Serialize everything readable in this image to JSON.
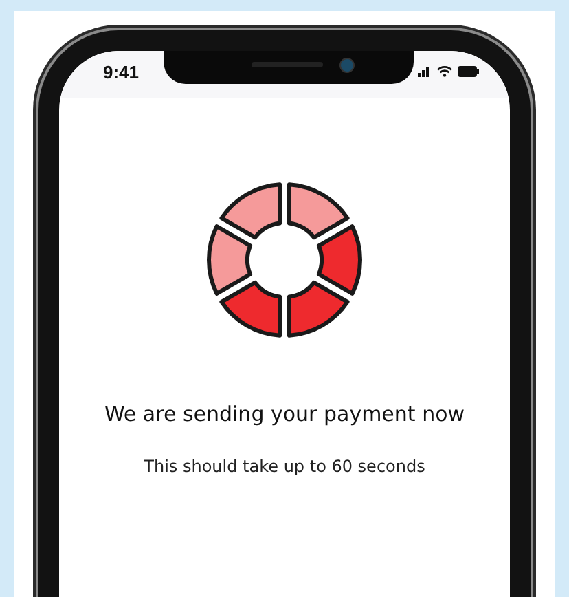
{
  "status_bar": {
    "time": "9:41"
  },
  "spinner": {
    "segments": [
      {
        "color": "#f59a9a"
      },
      {
        "color": "#ee2a2e"
      },
      {
        "color": "#ee2a2e"
      },
      {
        "color": "#ee2a2e"
      },
      {
        "color": "#f59a9a"
      },
      {
        "color": "#f59a9a"
      }
    ]
  },
  "title": "We are sending your payment now",
  "subtitle": "This should take up to 60 seconds"
}
